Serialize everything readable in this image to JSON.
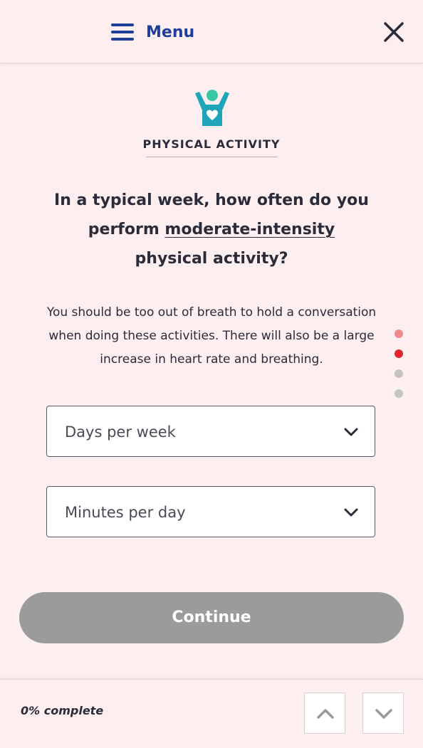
{
  "header": {
    "menu_label": "Menu",
    "menu_icon": "hamburger-icon",
    "close_icon": "close-icon"
  },
  "category": {
    "icon": "person-heart-icon",
    "title": "PHYSICAL ACTIVITY"
  },
  "question": {
    "before": "In a typical week, how often do you perform ",
    "emphasis": "moderate-intensity",
    "after": " physical activity?"
  },
  "helper_text": "You should be too out of breath to hold a conversation when doing these activities. There will also be a large increase in heart rate and breathing.",
  "selects": [
    {
      "placeholder": "Days per week",
      "icon": "chevron-down-icon"
    },
    {
      "placeholder": "Minutes per day",
      "icon": "chevron-down-icon"
    }
  ],
  "step_dots": [
    {
      "state": "visited",
      "color": "#ee8a8f"
    },
    {
      "state": "current",
      "color": "#e0242f"
    },
    {
      "state": "upcoming",
      "color": "#c4c4c4"
    },
    {
      "state": "upcoming",
      "color": "#c4c4c4"
    }
  ],
  "continue_label": "Continue",
  "footer": {
    "progress_label": "0% complete",
    "progress_value": 0,
    "prev_icon": "chevron-up-icon",
    "next_icon": "chevron-down-icon"
  },
  "colors": {
    "background": "#fdefef",
    "brand_blue": "#1f3e9c",
    "icon_teal": "#1ea6b8",
    "icon_head": "#37c9a6",
    "button_disabled": "#9b9b9b"
  }
}
